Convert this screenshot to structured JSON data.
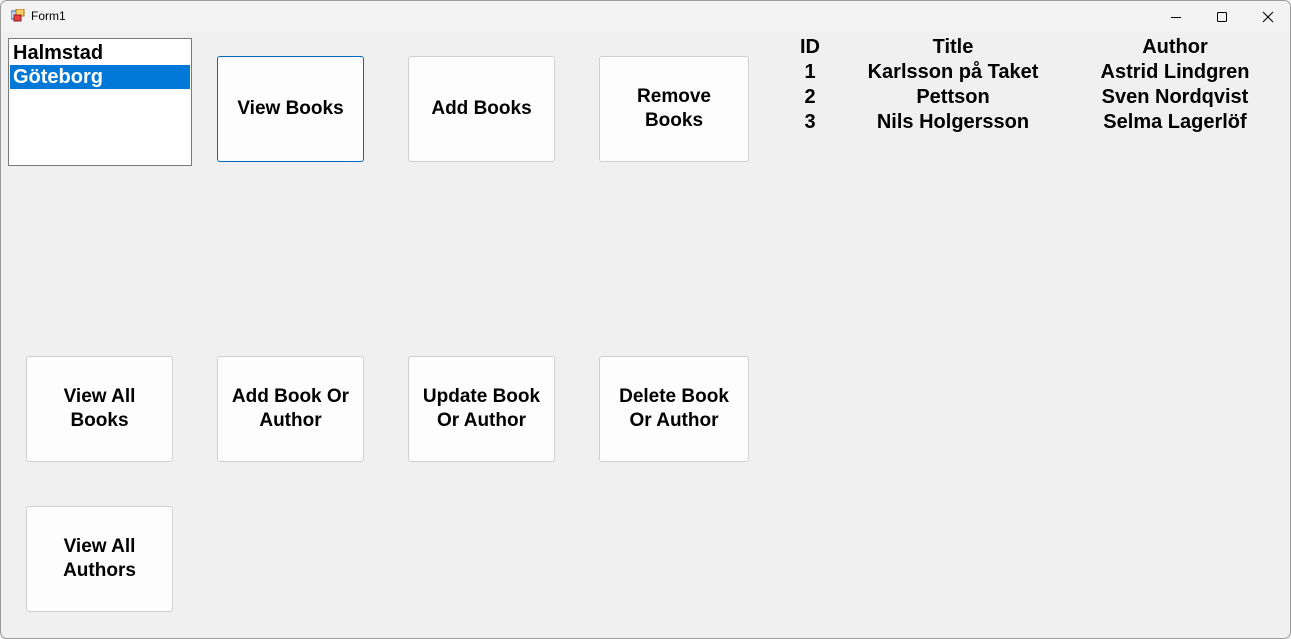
{
  "window": {
    "title": "Form1"
  },
  "listbox": {
    "items": [
      {
        "label": "Halmstad",
        "selected": false
      },
      {
        "label": "Göteborg",
        "selected": true
      }
    ]
  },
  "buttons": {
    "view_books": "View Books",
    "add_books": "Add Books",
    "remove_books": "Remove Books",
    "view_all_books": "View All Books",
    "add_book_or_author": "Add Book Or Author",
    "update_book_or_author": "Update Book Or Author",
    "delete_book_or_author": "Delete Book Or Author",
    "view_all_authors": "View All Authors"
  },
  "books_table": {
    "headers": {
      "id": "ID",
      "title": "Title",
      "author": "Author"
    },
    "rows": [
      {
        "id": "1",
        "title": "Karlsson på Taket",
        "author": "Astrid Lindgren"
      },
      {
        "id": "2",
        "title": "Pettson",
        "author": "Sven Nordqvist"
      },
      {
        "id": "3",
        "title": "Nils Holgersson",
        "author": "Selma Lagerlöf"
      }
    ]
  },
  "colors": {
    "selection": "#0078d7",
    "focus_border": "#0067c0",
    "background": "#f0f0f0"
  }
}
